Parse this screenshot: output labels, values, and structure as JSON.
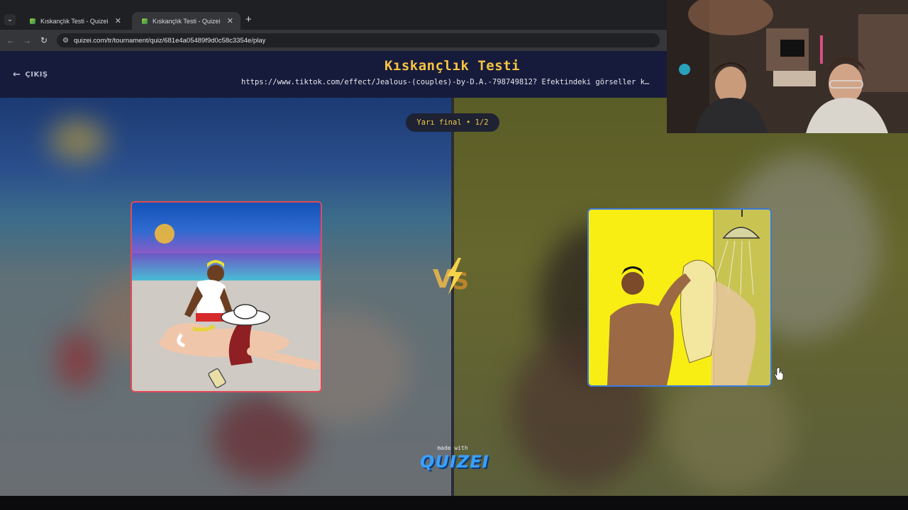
{
  "browser": {
    "tabs": [
      {
        "title": "Kıskançlık Testi - Quizei",
        "active": false
      },
      {
        "title": "Kıskançlık Testi - Quizei",
        "active": true
      }
    ],
    "new_tab_symbol": "+",
    "url": "quizei.com/tr/tournament/quiz/681e4a05489f9d0c58c3354e/play"
  },
  "header": {
    "back_label": "ÇIKIŞ",
    "title": "Kıskançlık Testi",
    "description": "https://www.tiktok.com/effect/Jealous-(couples)-by-D.A.-798749812? Efektindeki görseller k…"
  },
  "round": {
    "label": "Yarı final • 1/2"
  },
  "matchup": {
    "left_icon": "beach-sunscreen-illustration",
    "right_icon": "shower-illustration",
    "vs_icon": "vs-lightning-icon"
  },
  "footer": {
    "made_with": "made with",
    "brand": "QUIZEI"
  },
  "colors": {
    "title": "#f5c441",
    "left_border": "#e04b5a",
    "right_border": "#3d7bdc",
    "header_bg": "#171b3b"
  }
}
